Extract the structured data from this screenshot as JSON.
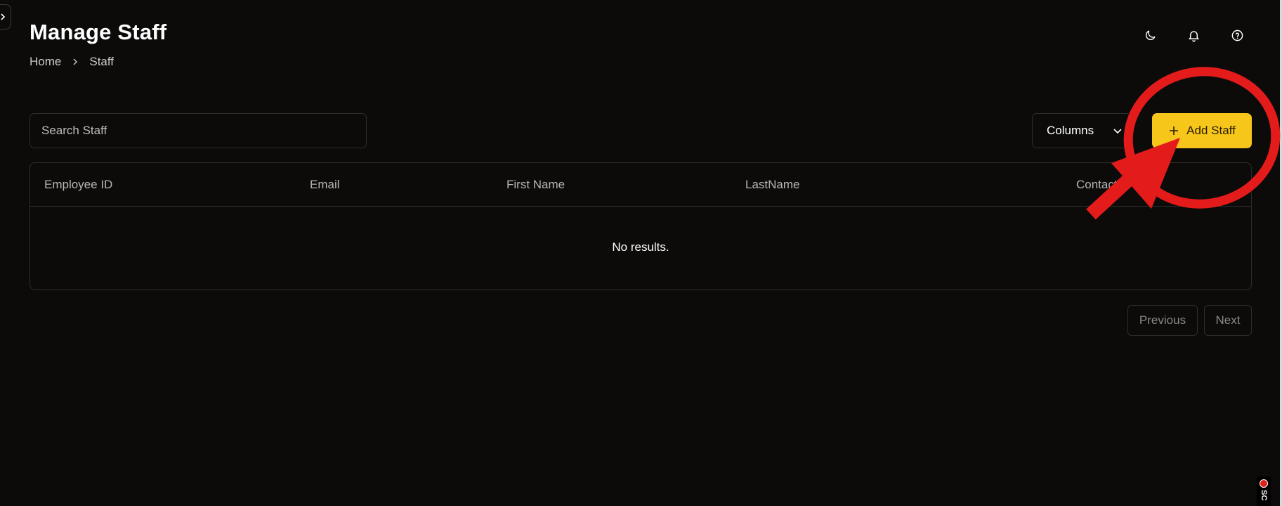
{
  "header": {
    "title": "Manage Staff",
    "breadcrumb": [
      "Home",
      "Staff"
    ],
    "icons": [
      "moon-icon",
      "bell-icon",
      "help-circle-icon"
    ]
  },
  "toolbar": {
    "search_placeholder": "Search Staff",
    "search_value": "",
    "columns_label": "Columns",
    "add_label": "Add Staff",
    "add_color": "#f6c61a"
  },
  "table": {
    "columns": [
      "Employee ID",
      "Email",
      "First Name",
      "LastName",
      "Contact"
    ],
    "empty_message": "No results."
  },
  "pagination": {
    "previous_label": "Previous",
    "next_label": "Next"
  },
  "annotation": {
    "color": "#e41b1b",
    "shapes": [
      "ellipse-highlight",
      "arrow"
    ]
  },
  "recording": {
    "label": "SC"
  }
}
